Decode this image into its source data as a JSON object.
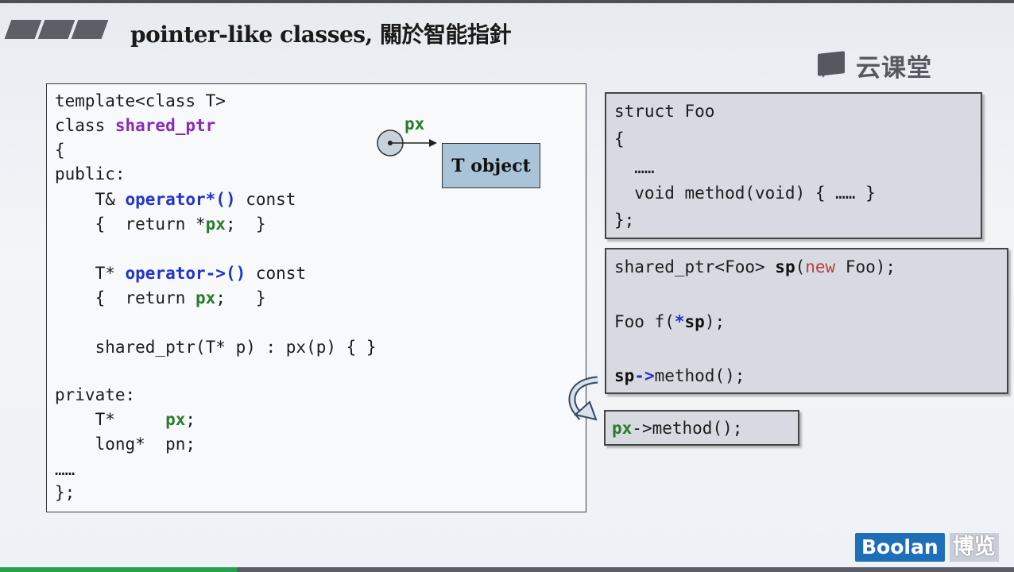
{
  "slide": {
    "title": "pointer-like classes, 關於智能指針",
    "brand_text": "云课堂",
    "footer_logo_text": "Boolan",
    "footer_logo_cn": "博览"
  },
  "diagram": {
    "px_label": "px",
    "t_object_label": "T object"
  },
  "main_code": {
    "l1": "template<class T>",
    "l2_kw": "class ",
    "l2_name": "shared_ptr",
    "l3": "{",
    "l4": "public:",
    "l5_a": "    T& ",
    "l5_op": "operator*()",
    "l5_b": " const",
    "l6_a": "    {  return *",
    "l6_px": "px",
    "l6_b": ";  }",
    "l7_a": "    T* ",
    "l7_op": "operator->()",
    "l7_b": " const",
    "l8_a": "    {  return ",
    "l8_px": "px",
    "l8_b": ";   }",
    "l9": "    shared_ptr(T* p) : px(p) { }",
    "l10": "private:",
    "l11_a": "    T*     ",
    "l11_px": "px",
    "l11_b": ";",
    "l12": "    long*  pn;",
    "l13": "……",
    "l14": "};"
  },
  "foo_code": {
    "l1": "struct Foo",
    "l2": "{",
    "l3": "  ……",
    "l4": "  void method(void) { …… }",
    "l5": "};"
  },
  "usage_code": {
    "l1_a": "shared_ptr<Foo> ",
    "l1_sp": "sp",
    "l1_b": "(",
    "l1_new": "new",
    "l1_c": " Foo);",
    "l2_a": "Foo f(",
    "l2_star": "*",
    "l2_sp": "sp",
    "l2_b": ");",
    "l3_sp": "sp",
    "l3_arrow": "->",
    "l3_b": "method();"
  },
  "px_code": {
    "px": "px",
    "rest": "->method();"
  },
  "colors": {
    "purple": "#8a2bb8",
    "blue": "#2233cc",
    "green": "#2a7b2a",
    "red": "#b84040",
    "t_object_fill": "#a9c3d8",
    "box_gray": "#d7dae1",
    "boolan_blue": "#1d6fb8",
    "progress_green": "#27a24b"
  }
}
